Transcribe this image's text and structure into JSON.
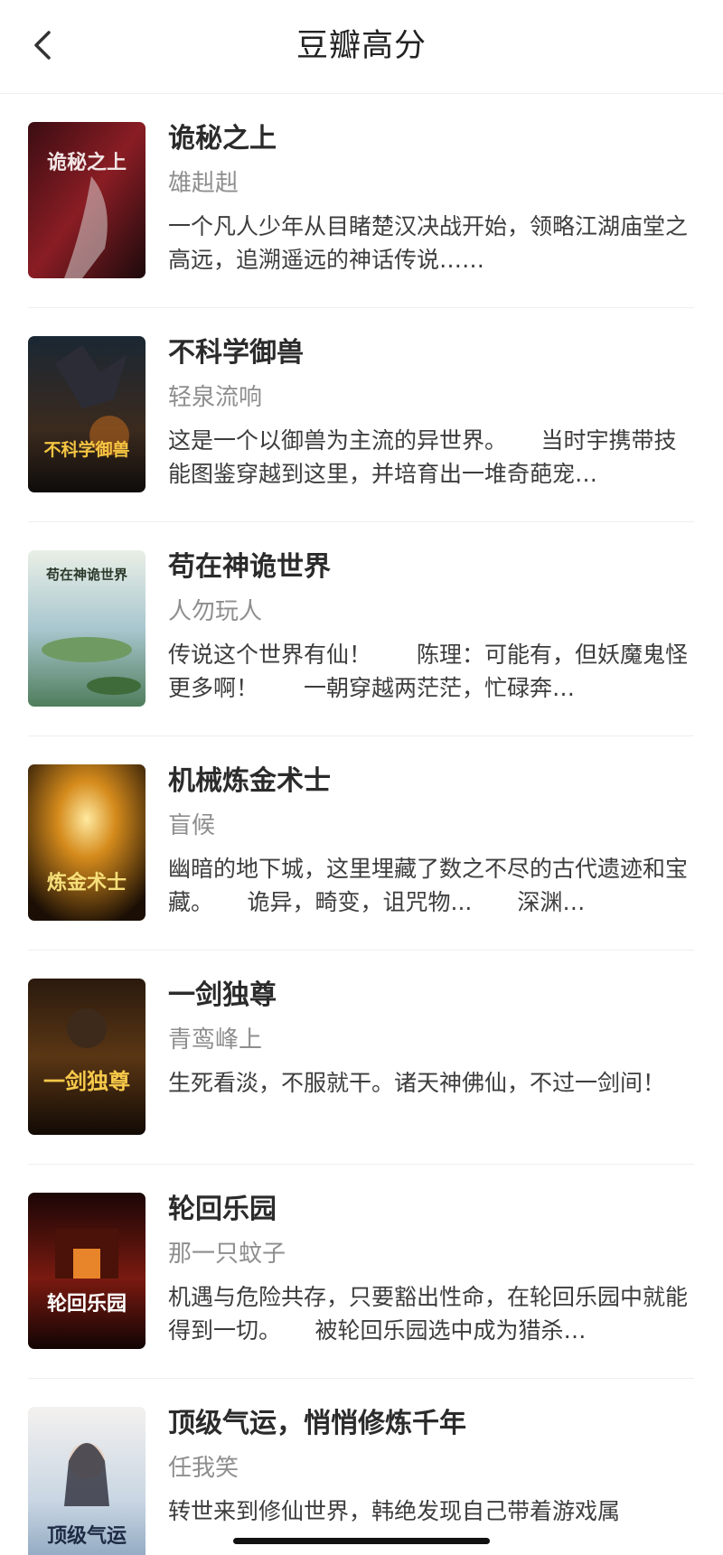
{
  "header": {
    "title": "豆瓣高分",
    "back_icon": "chevron-left-icon"
  },
  "books": [
    {
      "title": "诡秘之上",
      "author": "雄赳赳",
      "description": "一个凡人少年从目睹楚汉决战开始，领略江湖庙堂之高远，追溯遥远的神话传说……",
      "cover_text": "诡秘之上"
    },
    {
      "title": "不科学御兽",
      "author": "轻泉流响",
      "description": "这是一个以御兽为主流的异世界。　　当时宇携带技能图鉴穿越到这里，并培育出一堆奇葩宠…",
      "cover_text": "不科学御兽"
    },
    {
      "title": "苟在神诡世界",
      "author": "人勿玩人",
      "description": "传说这个世界有仙！　　陈理：可能有，但妖魔鬼怪更多啊！　　一朝穿越两茫茫，忙碌奔…",
      "cover_text": "苟在神诡世界"
    },
    {
      "title": "机械炼金术士",
      "author": "盲候",
      "description": "幽暗的地下城，这里埋藏了数之不尽的古代遗迹和宝藏。　　诡异，畸变，诅咒物...　　深渊…",
      "cover_text": "炼金术士"
    },
    {
      "title": "一剑独尊",
      "author": "青鸾峰上",
      "description": "生死看淡，不服就干。诸天神佛仙，不过一剑间！",
      "cover_text": "一剑独尊"
    },
    {
      "title": "轮回乐园",
      "author": "那一只蚊子",
      "description": "机遇与危险共存，只要豁出性命，在轮回乐园中就能得到一切。　　被轮回乐园选中成为猎杀…",
      "cover_text": "轮回乐园"
    },
    {
      "title": "顶级气运，悄悄修炼千年",
      "author": "任我笑",
      "description": "转世来到修仙世界，韩绝发现自己带着游戏属",
      "cover_text": "顶级气运"
    }
  ],
  "colors": {
    "title": "#2b2b2b",
    "author": "#8e8e8e",
    "description": "#3d3d3d",
    "separator": "#eeeeee"
  }
}
